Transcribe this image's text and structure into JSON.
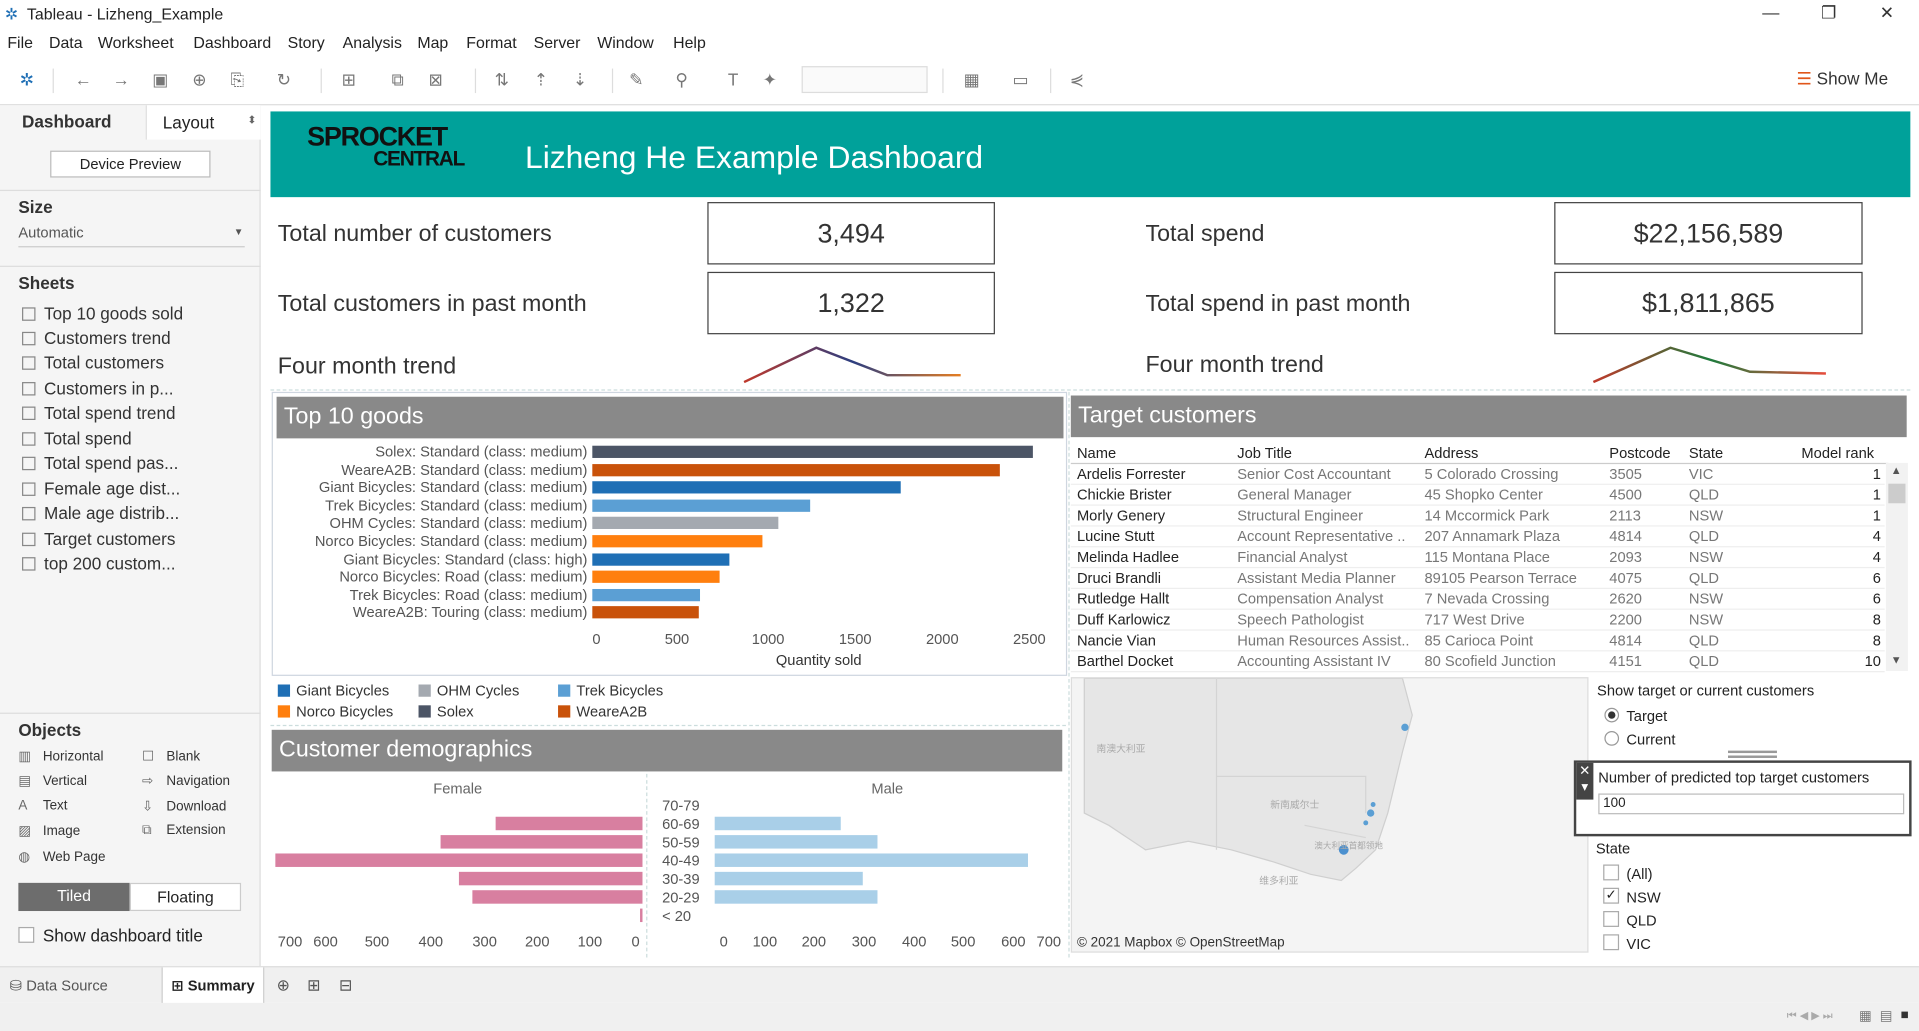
{
  "window": {
    "title": "Tableau - Lizheng_Example",
    "minimize": "—",
    "maximize": "❐",
    "close": "✕"
  },
  "menu": [
    "File",
    "Data",
    "Worksheet",
    "Dashboard",
    "Story",
    "Analysis",
    "Map",
    "Format",
    "Server",
    "Window",
    "Help"
  ],
  "toolbar": {
    "show_me": "Show Me"
  },
  "sidebar": {
    "tab_dashboard": "Dashboard",
    "tab_layout": "Layout",
    "device_preview": "Device Preview",
    "size_heading": "Size",
    "size_value": "Automatic",
    "sheets_heading": "Sheets",
    "sheets": [
      "Top 10 goods sold",
      "Customers trend",
      "Total customers",
      "Customers in p...",
      "Total spend trend",
      "Total spend",
      "Total spend pas...",
      "Female age dist...",
      "Male age distrib...",
      "Target customers",
      "top 200 custom..."
    ],
    "objects_heading": "Objects",
    "objects": [
      {
        "label": "Horizontal",
        "icon": "▥"
      },
      {
        "label": "Blank",
        "icon": "☐"
      },
      {
        "label": "Vertical",
        "icon": "▤"
      },
      {
        "label": "Navigation",
        "icon": "⇨"
      },
      {
        "label": "Text",
        "icon": "A"
      },
      {
        "label": "Download",
        "icon": "⇩"
      },
      {
        "label": "Image",
        "icon": "▨"
      },
      {
        "label": "Extension",
        "icon": "⧉"
      },
      {
        "label": "Web Page",
        "icon": "◍"
      }
    ],
    "tiled": "Tiled",
    "floating": "Floating",
    "show_title": "Show dashboard title"
  },
  "dashboard": {
    "logo_line1": "SPROCKET",
    "logo_line2": "CENTRAL",
    "title": "Lizheng He Example Dashboard",
    "kpi": {
      "total_customers_label": "Total number of customers",
      "total_customers_value": "3,494",
      "past_month_customers_label": "Total customers in past month",
      "past_month_customers_value": "1,322",
      "trend_label_left": "Four month trend",
      "total_spend_label": "Total spend",
      "total_spend_value": "$22,156,589",
      "past_month_spend_label": "Total spend in past month",
      "past_month_spend_value": "$1,811,865",
      "trend_label_right": "Four month trend"
    },
    "goods": {
      "title": "Top 10 goods",
      "xlabel": "Quantity sold",
      "legend": [
        {
          "name": "Giant Bicycles",
          "color": "#1f6fb5"
        },
        {
          "name": "OHM Cycles",
          "color": "#a4a9b0"
        },
        {
          "name": "Trek Bicycles",
          "color": "#5b9fd4"
        },
        {
          "name": "Norco Bicycles",
          "color": "#ff7f0e"
        },
        {
          "name": "Solex",
          "color": "#4c5566"
        },
        {
          "name": "WeareA2B",
          "color": "#c9520a"
        }
      ]
    },
    "demographics": {
      "title": "Customer demographics",
      "female": "Female",
      "male": "Male"
    },
    "target": {
      "title": "Target customers",
      "columns": [
        "Name",
        "Job Title",
        "Address",
        "Postcode",
        "State",
        "Model rank"
      ],
      "rows": [
        [
          "Ardelis Forrester",
          "Senior Cost Accountant",
          "5 Colorado Crossing",
          "3505",
          "VIC",
          "1"
        ],
        [
          "Chickie Brister",
          "General Manager",
          "45 Shopko Center",
          "4500",
          "QLD",
          "1"
        ],
        [
          "Morly Genery",
          "Structural Engineer",
          "14 Mccormick Park",
          "2113",
          "NSW",
          "1"
        ],
        [
          "Lucine Stutt",
          "Account Representative ..",
          "207 Annamark Plaza",
          "4814",
          "QLD",
          "4"
        ],
        [
          "Melinda Hadlee",
          "Financial Analyst",
          "115 Montana Place",
          "2093",
          "NSW",
          "4"
        ],
        [
          "Druci Brandli",
          "Assistant Media Planner",
          "89105 Pearson Terrace",
          "4075",
          "QLD",
          "6"
        ],
        [
          "Rutledge Hallt",
          "Compensation Analyst",
          "7 Nevada Crossing",
          "2620",
          "NSW",
          "6"
        ],
        [
          "Duff Karlowicz",
          "Speech Pathologist",
          "717 West Drive",
          "2200",
          "NSW",
          "8"
        ],
        [
          "Nancie Vian",
          "Human Resources Assist..",
          "85 Carioca Point",
          "4814",
          "QLD",
          "8"
        ],
        [
          "Barthel Docket",
          "Accounting Assistant IV",
          "80 Scofield Junction",
          "4151",
          "QLD",
          "10"
        ]
      ]
    },
    "map": {
      "attribution": "© 2021 Mapbox © OpenStreetMap",
      "label_sa": "南澳大利亚",
      "label_nsw": "新南威尔士",
      "label_act": "澳大利亚首都领地",
      "label_vic": "维多利亚"
    },
    "filters": {
      "show_label": "Show target or current customers",
      "opt_target": "Target",
      "opt_current": "Current",
      "number_label": "Number of predicted top target customers",
      "number_value": "100",
      "state_label": "State",
      "states": [
        "(All)",
        "NSW",
        "QLD",
        "VIC"
      ],
      "state_checked": [
        false,
        true,
        false,
        false
      ]
    }
  },
  "bottom": {
    "data_source": "Data Source",
    "summary": "Summary"
  },
  "chart_data": [
    {
      "type": "bar",
      "title": "Top 10 goods",
      "xlabel": "Quantity sold",
      "categories": [
        "Solex: Standard (class: medium)",
        "WeareA2B: Standard (class: medium)",
        "Giant Bicycles: Standard (class: medium)",
        "Trek Bicycles: Standard (class: medium)",
        "OHM Cycles: Standard (class: medium)",
        "Norco Bicycles: Standard (class: medium)",
        "Giant Bicycles: Standard (class: high)",
        "Norco Bicycles: Road (class: medium)",
        "Trek Bicycles: Road (class: medium)",
        "WeareA2B: Touring (class: medium)"
      ],
      "values": [
        2530,
        2340,
        1770,
        1250,
        1070,
        980,
        790,
        730,
        620,
        610
      ],
      "series_of": [
        "Solex",
        "WeareA2B",
        "Giant Bicycles",
        "Trek Bicycles",
        "OHM Cycles",
        "Norco Bicycles",
        "Giant Bicycles",
        "Norco Bicycles",
        "Trek Bicycles",
        "WeareA2B"
      ],
      "xticks": [
        0,
        500,
        1000,
        1500,
        2000,
        2500
      ],
      "xlim": [
        0,
        2600
      ]
    },
    {
      "type": "bar",
      "title": "Customer demographics",
      "categories": [
        "70-79",
        "60-69",
        "50-59",
        "40-49",
        "30-39",
        "20-29",
        "< 20"
      ],
      "series": [
        {
          "name": "Female",
          "values": [
            0,
            280,
            385,
            700,
            350,
            325,
            5
          ]
        },
        {
          "name": "Male",
          "values": [
            0,
            255,
            330,
            635,
            300,
            330,
            0
          ]
        }
      ],
      "xticks_female": [
        700,
        600,
        500,
        400,
        300,
        200,
        100,
        0
      ],
      "xticks_male": [
        0,
        100,
        200,
        300,
        400,
        500,
        600,
        700
      ]
    },
    {
      "type": "line",
      "title": "Four month trend",
      "x": [
        1,
        2,
        3,
        4
      ],
      "values": [
        1,
        3,
        1.4,
        1.4
      ]
    },
    {
      "type": "line",
      "title": "Four month trend",
      "x": [
        1,
        2,
        3,
        4
      ],
      "values": [
        1,
        3,
        1.6,
        1.5
      ]
    }
  ]
}
